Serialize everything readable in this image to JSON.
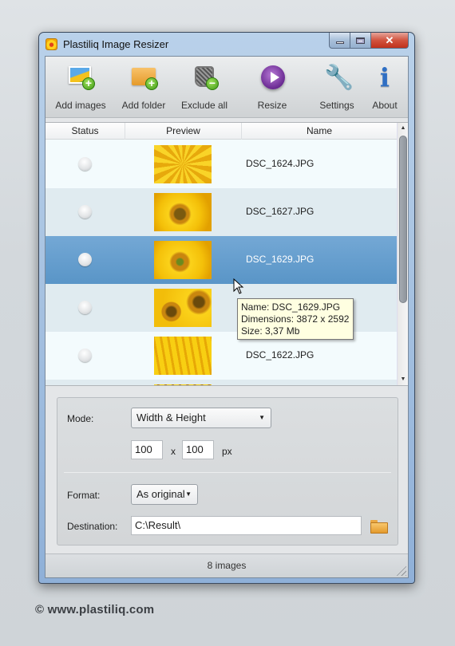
{
  "window": {
    "title": "Plastiliq Image Resizer",
    "caption_buttons": {
      "minimize": "minimize",
      "maximize": "maximize",
      "close": "✕"
    }
  },
  "toolbar": {
    "items": [
      {
        "label": "Add images",
        "icon": "add-images-icon"
      },
      {
        "label": "Add folder",
        "icon": "add-folder-icon"
      },
      {
        "label": "Exclude all",
        "icon": "exclude-all-icon"
      },
      {
        "label": "Resize",
        "icon": "play-icon"
      },
      {
        "label": "Settings",
        "icon": "wrench-icon"
      },
      {
        "label": "About",
        "icon": "info-icon"
      }
    ]
  },
  "list": {
    "columns": [
      "Status",
      "Preview",
      "Name"
    ],
    "rows": [
      {
        "name": "DSC_1624.JPG",
        "selected": false
      },
      {
        "name": "DSC_1627.JPG",
        "selected": false
      },
      {
        "name": "DSC_1629.JPG",
        "selected": true
      },
      {
        "name": "",
        "selected": false
      },
      {
        "name": "DSC_1622.JPG",
        "selected": false
      }
    ],
    "tooltip": {
      "line1": "Name: DSC_1629.JPG",
      "line2": "Dimensions: 3872 x 2592",
      "line3": "Size: 3,37 Mb"
    },
    "scroll_up": "▲",
    "scroll_down": "▼"
  },
  "settings": {
    "mode_label": "Mode:",
    "mode_value": "Width & Height",
    "width_value": "100",
    "times": "x",
    "height_value": "100",
    "unit": "px",
    "format_label": "Format:",
    "format_value": "As original",
    "destination_label": "Destination:",
    "destination_value": "C:\\Result\\",
    "dropdown_arrow": "▼"
  },
  "statusbar": {
    "text": "8 images"
  },
  "footer": {
    "copyright": "© www.plastiliq.com"
  },
  "colors": {
    "selected_row": "#5f9acb",
    "tooltip_bg": "#ffffe1",
    "close_button": "#c8402a"
  }
}
